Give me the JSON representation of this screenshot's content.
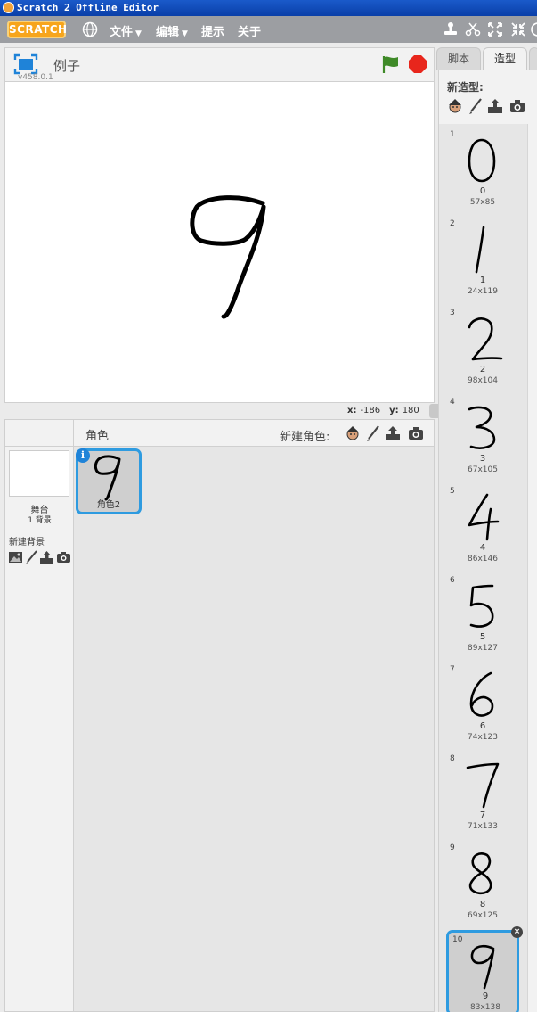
{
  "window": {
    "title": "Scratch 2 Offline Editor"
  },
  "menubar": {
    "logo": "SCRATCH",
    "items": [
      {
        "label": "文件",
        "caret": "▼"
      },
      {
        "label": "编辑",
        "caret": "▼"
      },
      {
        "label": "提示",
        "caret": ""
      },
      {
        "label": "关于",
        "caret": ""
      }
    ]
  },
  "stage": {
    "project_title": "例子",
    "version": "v458.0.1",
    "digit": "9",
    "coords": {
      "x_label": "x:",
      "x_value": "-186",
      "y_label": "y:",
      "y_value": "180"
    }
  },
  "sprites": {
    "header_label": "角色",
    "new_sprite_label": "新建角色:",
    "stage_name": "舞台",
    "stage_backdrops": "1 背景",
    "new_backdrop_label": "新建背景",
    "list": [
      {
        "name": "角色2",
        "digit": "9",
        "info": "i"
      }
    ]
  },
  "tabs": [
    {
      "label": "脚本",
      "active": false
    },
    {
      "label": "造型",
      "active": true
    }
  ],
  "costumes": {
    "new_costume_label": "新造型:",
    "items": [
      {
        "index": "1",
        "name": "0",
        "size": "57x85"
      },
      {
        "index": "2",
        "name": "1",
        "size": "24x119"
      },
      {
        "index": "3",
        "name": "2",
        "size": "98x104"
      },
      {
        "index": "4",
        "name": "3",
        "size": "67x105"
      },
      {
        "index": "5",
        "name": "4",
        "size": "86x146"
      },
      {
        "index": "6",
        "name": "5",
        "size": "89x127"
      },
      {
        "index": "7",
        "name": "6",
        "size": "74x123"
      },
      {
        "index": "8",
        "name": "7",
        "size": "71x133"
      },
      {
        "index": "9",
        "name": "8",
        "size": "69x125"
      },
      {
        "index": "10",
        "name": "9",
        "size": "83x138",
        "selected": true
      }
    ]
  },
  "colors": {
    "accent": "#2e9be0",
    "menubar": "#9c9ea2",
    "logo": "#f7a51c",
    "flag": "#3f8a28",
    "stop": "#e8261c"
  }
}
